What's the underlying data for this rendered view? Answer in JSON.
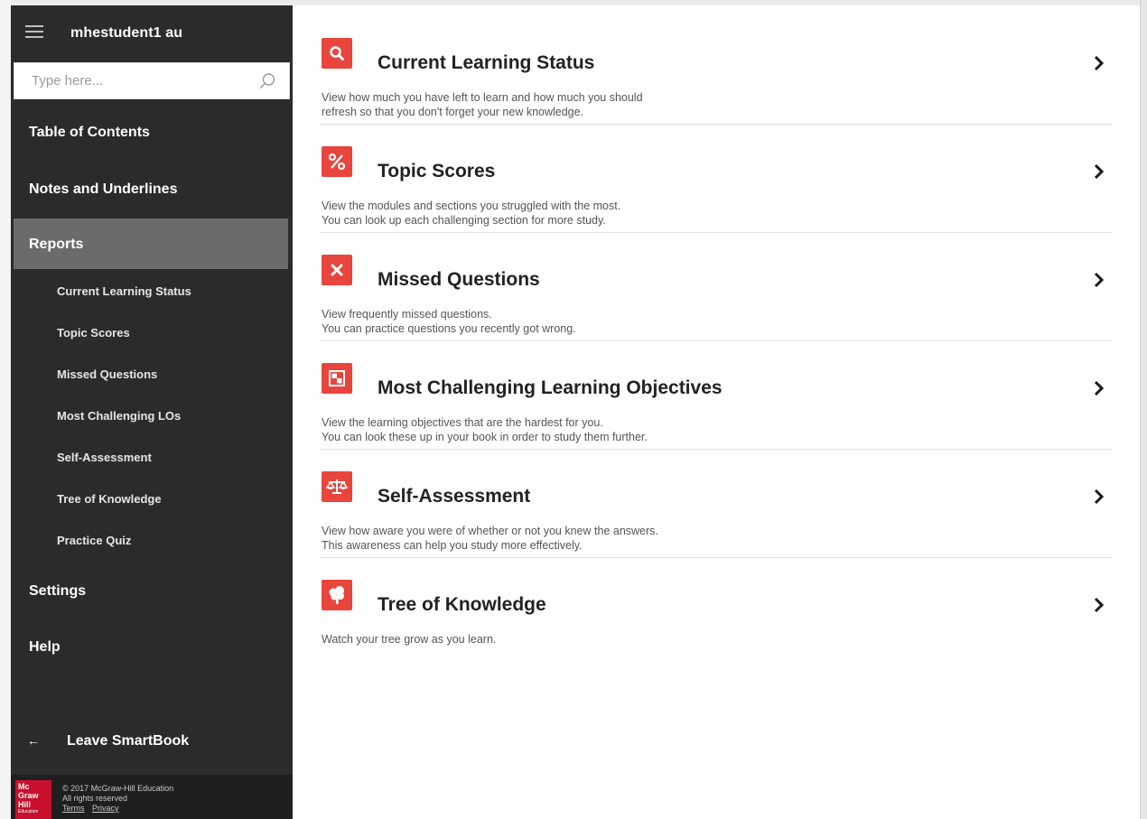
{
  "sidebar": {
    "username": "mhestudent1 au",
    "search_placeholder": "Type here...",
    "nav": {
      "table_of_contents": "Table of Contents",
      "notes_and_underlines": "Notes and Underlines",
      "reports": "Reports",
      "settings": "Settings",
      "help": "Help"
    },
    "sub_items": [
      "Current Learning Status",
      "Topic Scores",
      "Missed Questions",
      "Most Challenging LOs",
      "Self-Assessment",
      "Tree of Knowledge",
      "Practice Quiz"
    ],
    "leave": {
      "arrow": "←",
      "label": "Leave SmartBook"
    },
    "footer": {
      "logo_lines": [
        "Mc",
        "Graw",
        "Hill",
        "Education"
      ],
      "copyright": "© 2017 McGraw-Hill Education",
      "rights": "All rights reserved",
      "terms": "Terms",
      "privacy": "Privacy"
    }
  },
  "reports": [
    {
      "title": "Current Learning Status",
      "icon": "magnifier-icon",
      "desc": [
        "View how much you have left to learn and how much you should",
        "refresh so that you don't forget your new knowledge."
      ]
    },
    {
      "title": "Topic Scores",
      "icon": "percent-icon",
      "desc": [
        "View the modules and sections you struggled with the most.",
        "You can look up each challenging section for more study."
      ]
    },
    {
      "title": "Missed Questions",
      "icon": "x-icon",
      "desc": [
        "View frequently missed questions.",
        "You can practice questions you recently got wrong."
      ]
    },
    {
      "title": "Most Challenging Learning Objectives",
      "icon": "objectives-icon",
      "desc": [
        "View the learning objectives that are the hardest for you.",
        "You can look these up in your book in order to study them further."
      ]
    },
    {
      "title": "Self-Assessment",
      "icon": "scale-icon",
      "desc": [
        "View how aware you were of whether or not you knew the answers.",
        "This awareness can help you study more effectively."
      ]
    },
    {
      "title": "Tree of Knowledge",
      "icon": "tree-icon",
      "desc": [
        "Watch your tree grow as you learn."
      ]
    }
  ],
  "colors": {
    "sidebar_bg": "#2b2b2b",
    "sidebar_active": "#6b6b6b",
    "accent_red": "#e8453c"
  }
}
